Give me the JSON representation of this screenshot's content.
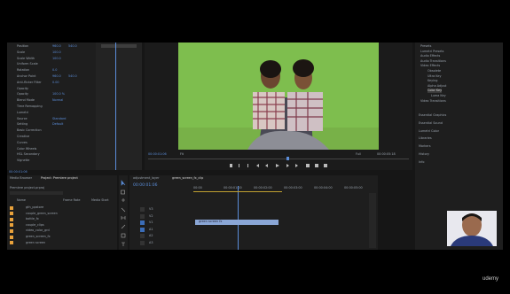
{
  "effect_controls": {
    "rows": [
      {
        "label": "Position",
        "v1": "960.0",
        "v2": "540.0"
      },
      {
        "label": "Scale",
        "v1": "100.0",
        "v2": ""
      },
      {
        "label": "Scale Width",
        "v1": "100.0",
        "v2": ""
      },
      {
        "label": "Uniform Scale",
        "v1": "",
        "v2": ""
      },
      {
        "label": "Rotation",
        "v1": "0.0",
        "v2": ""
      },
      {
        "label": "Anchor Point",
        "v1": "960.0",
        "v2": "540.0"
      },
      {
        "label": "Anti-flicker Filter",
        "v1": "0.00",
        "v2": ""
      },
      {
        "label": "Opacity",
        "v1": "",
        "v2": ""
      },
      {
        "label": "Opacity",
        "v1": "100.0 %",
        "v2": ""
      },
      {
        "label": "Blend Mode",
        "v1": "Normal",
        "v2": ""
      },
      {
        "label": "Time Remapping",
        "v1": "",
        "v2": ""
      },
      {
        "label": "Lumetri",
        "v1": "",
        "v2": ""
      },
      {
        "label": "Source",
        "v1": "Standard",
        "v2": ""
      },
      {
        "label": "Setting",
        "v1": "Default",
        "v2": ""
      },
      {
        "label": "Basic Correction",
        "v1": "",
        "v2": ""
      },
      {
        "label": "Creative",
        "v1": "",
        "v2": ""
      },
      {
        "label": "Curves",
        "v1": "",
        "v2": ""
      },
      {
        "label": "Color Wheels",
        "v1": "",
        "v2": ""
      },
      {
        "label": "HSL Secondary",
        "v1": "",
        "v2": ""
      },
      {
        "label": "Vignette",
        "v1": "",
        "v2": ""
      }
    ],
    "timecode": "00:00:01:06"
  },
  "program_monitor": {
    "timecode": "00:00:01:06",
    "fit": "Fit",
    "quality": "Full",
    "duration": "00:00:05:18"
  },
  "effects_panel": {
    "items": [
      "Presets",
      "Lumetri Presets",
      "Audio Effects",
      "Audio Transitions",
      "Video Effects",
      "Obsolete",
      "Ultra Key",
      "Keying",
      "Alpha Adjust",
      "Color Key",
      "Luma Key",
      "Video Transitions"
    ],
    "sections": [
      "Essential Graphics",
      "Essential Sound",
      "Lumetri Color",
      "Libraries",
      "Markers",
      "History",
      "Info"
    ]
  },
  "project_panel": {
    "tabs": [
      "Media Browser",
      "Project: Premiere project"
    ],
    "title": "Premiere project.prproj",
    "columns": [
      "Name",
      "Frame Rate",
      "Media Start"
    ],
    "items": [
      "gth_ppstore",
      "couple_green_screen",
      "bottle_fx",
      "couple_clips",
      "video_color_grd",
      "green_screen_fx",
      "green screen"
    ],
    "info": "1 of 7 items selected"
  },
  "timeline": {
    "tabs": [
      "adjustment_layer",
      "green_screen_fx_clip"
    ],
    "timecode": "00:00:01:06",
    "ruler": [
      "00:00",
      "00:00:01:00",
      "00:00:02:00",
      "00:00:03:00",
      "00:00:04:00",
      "00:00:05:00"
    ],
    "tracks": [
      "V3",
      "V2",
      "V1",
      "A1",
      "A2",
      "A3"
    ],
    "clip_label": "green screen fx"
  },
  "watermark": "udemy",
  "colors": {
    "accent": "#5b8dd9",
    "green_screen": "#7dbb4c",
    "panel": "#1e1e1e",
    "clip": "#8aa6d6"
  }
}
